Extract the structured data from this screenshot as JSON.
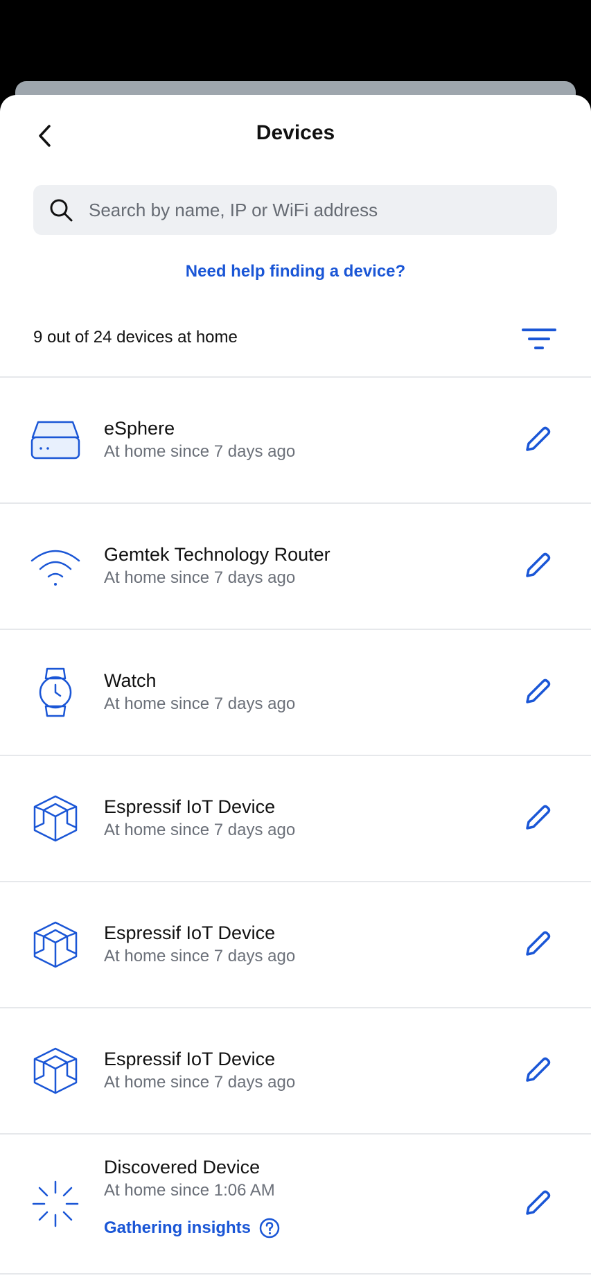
{
  "header": {
    "title": "Devices"
  },
  "search": {
    "placeholder": "Search by name, IP or WiFi address"
  },
  "help_link": "Need help finding a device?",
  "count_text": "9 out of 24 devices at home",
  "colors": {
    "accent": "#1a56d6",
    "text": "#111111",
    "subtext": "#6b7079",
    "search_bg": "#eef0f3",
    "divider": "#e6e8eb"
  },
  "devices": [
    {
      "name": "eSphere",
      "status": "At home since 7 days ago",
      "icon": "hub-icon"
    },
    {
      "name": "Gemtek Technology Router",
      "status": "At home since 7 days ago",
      "icon": "wifi-icon"
    },
    {
      "name": "Watch",
      "status": "At home since 7 days ago",
      "icon": "watch-icon"
    },
    {
      "name": "Espressif IoT Device",
      "status": "At home since 7 days ago",
      "icon": "cube-icon"
    },
    {
      "name": "Espressif IoT Device",
      "status": "At home since 7 days ago",
      "icon": "cube-icon"
    },
    {
      "name": "Espressif IoT Device",
      "status": "At home since 7 days ago",
      "icon": "cube-icon"
    },
    {
      "name": "Discovered Device",
      "status": "At home since 1:06 AM",
      "icon": "loading-spinner-icon",
      "insights": "Gathering insights"
    }
  ]
}
